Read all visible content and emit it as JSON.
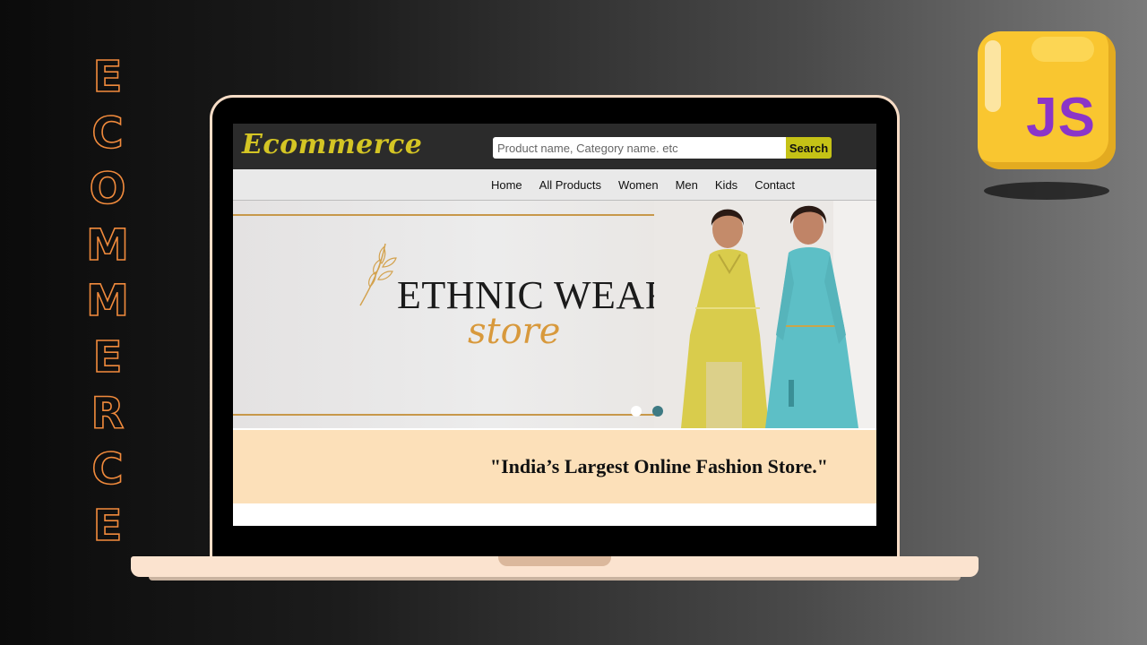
{
  "side_title": [
    "E",
    "C",
    "O",
    "M",
    "M",
    "E",
    "R",
    "C",
    "E"
  ],
  "badge": {
    "text": "JS"
  },
  "site": {
    "brand": "Ecommerce",
    "search": {
      "placeholder": "Product name, Category name. etc",
      "button_label": "Search"
    },
    "nav": [
      "Home",
      "All Products",
      "Women",
      "Men",
      "Kids",
      "Contact"
    ],
    "hero": {
      "title": "ETHNIC WEAR",
      "subtitle": "store",
      "slides": 2,
      "active_slide": 1
    },
    "tagline": "\"India’s Largest Online Fashion Store.\""
  },
  "colors": {
    "accent_title": "#f08a3c",
    "brand": "#d4c524",
    "search_button": "#c5c216",
    "tagline_band": "#fce0b9",
    "hero_gold": "#c7984a",
    "js_yellow": "#f9c630",
    "js_purple": "#8b35c8"
  }
}
